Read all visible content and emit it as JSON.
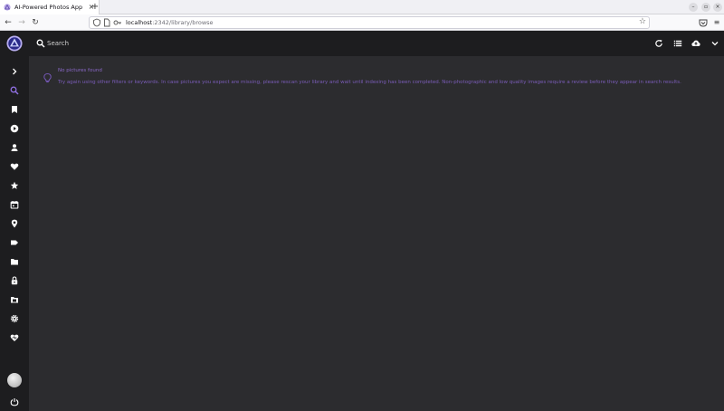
{
  "browser": {
    "tab_title": "AI-Powered Photos App",
    "tab_close": "×",
    "new_tab": "+",
    "win_minimize": "–",
    "win_restore": "▫",
    "win_close": "×",
    "back": "←",
    "forward": "→",
    "reload": "↻",
    "url_host": "localhost",
    "url_path": ":2342/library/browse",
    "menu": "≡"
  },
  "sidebar": {
    "items": [
      {
        "name": "expand-icon"
      },
      {
        "name": "search-icon",
        "active": true
      },
      {
        "name": "album-icon"
      },
      {
        "name": "video-icon"
      },
      {
        "name": "people-icon"
      },
      {
        "name": "favorites-icon"
      },
      {
        "name": "star-icon"
      },
      {
        "name": "calendar-icon"
      },
      {
        "name": "places-icon"
      },
      {
        "name": "labels-icon"
      },
      {
        "name": "folders-icon"
      },
      {
        "name": "private-icon"
      },
      {
        "name": "library-icon"
      },
      {
        "name": "settings-icon"
      },
      {
        "name": "support-icon"
      },
      {
        "name": "logout-icon"
      }
    ]
  },
  "toolbar": {
    "search_placeholder": "Search",
    "actions": [
      "reload-icon",
      "list-view-icon",
      "upload-icon",
      "expand-more-icon"
    ]
  },
  "content": {
    "alert_title": "No pictures found",
    "alert_text": "Try again using other filters or keywords. In case pictures you expect are missing, please rescan your library and wait until indexing has been completed. Non-photographic and low quality images require a review before they appear in search results."
  },
  "colors": {
    "accent": "#7c5cc4",
    "sidebar_bg": "#1d1d1f",
    "content_bg": "#2c2c2f"
  }
}
